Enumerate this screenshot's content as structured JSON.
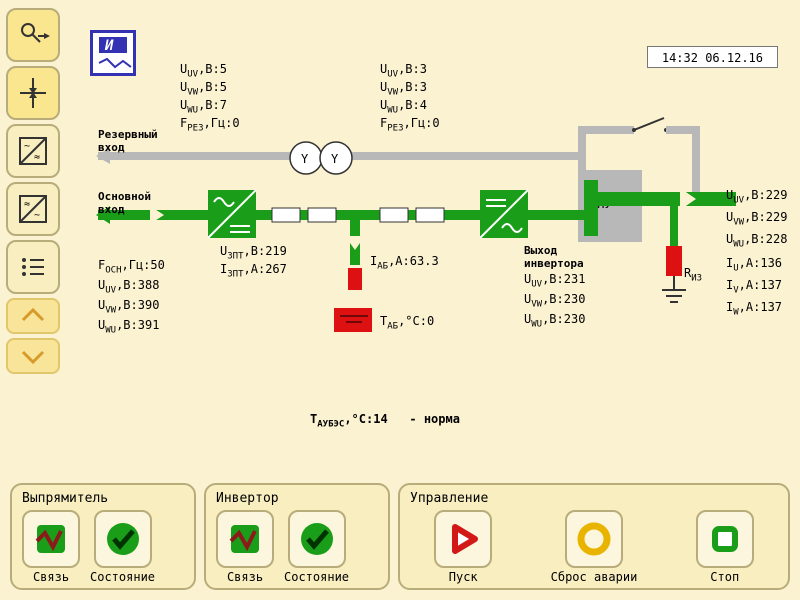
{
  "timestamp": "14:32 06.12.16",
  "reserve_input": {
    "label": "Резервный\nвход",
    "U_UV": 5,
    "U_VW": 5,
    "U_WU": 7,
    "F_REZ": 0
  },
  "reserve_input2": {
    "U_UV": 3,
    "U_VW": 3,
    "U_WU": 4,
    "F_REZ": 0
  },
  "main_input": {
    "label": "Основной\nвход",
    "F_OSN": 50,
    "U_UV": 388,
    "U_VW": 390,
    "U_WU": 391
  },
  "dc_link": {
    "U_ZPT": 219,
    "I_ZPT": 267
  },
  "battery": {
    "I_AB": 63.3,
    "T_AB": 0
  },
  "inverter_out": {
    "label": "Выход\nинвертора",
    "U_UV": 231,
    "U_VW": 230,
    "U_WU": 230
  },
  "epu_label": "ЭПУ",
  "r_iz_label": "R_ИЗ",
  "output": {
    "U_UV": 229,
    "U_VW": 229,
    "U_WU": 228,
    "I_U": 136,
    "I_V": 137,
    "I_W": 137
  },
  "temp": {
    "label": "T_АУБЭС,°C:",
    "val": 14,
    "status": "- норма"
  },
  "groups": {
    "rectifier": {
      "title": "Выпрямитель",
      "link": "Связь",
      "state": "Состояние"
    },
    "inverter": {
      "title": "Инвертор",
      "link": "Связь",
      "state": "Состояние"
    },
    "control": {
      "title": "Управление",
      "start": "Пуск",
      "reset": "Сброс аварии",
      "stop": "Стоп"
    }
  }
}
